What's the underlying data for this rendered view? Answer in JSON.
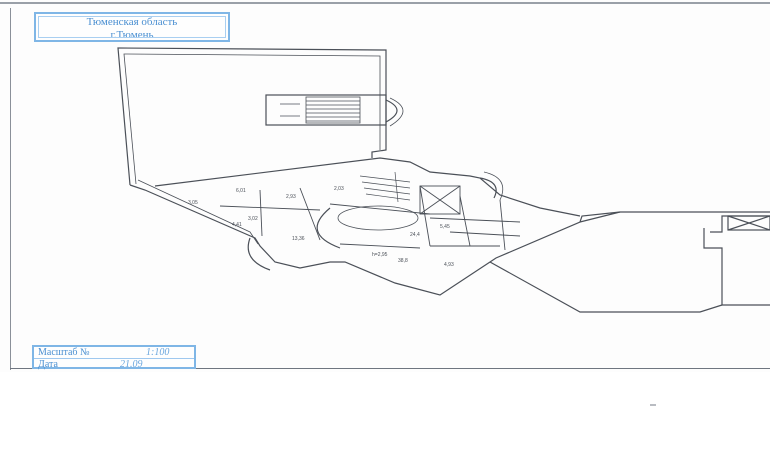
{
  "stamp_region": {
    "line1": "Тюменская область",
    "line2": "г.Тюмень"
  },
  "stamp_scale": {
    "scale_label": "Масштаб №",
    "scale_value": "1:100",
    "date_label": "Дата",
    "date_value": "21.09"
  },
  "room_labels": [
    "3,05",
    "6,01",
    "2,93",
    "3,02",
    "2,03",
    "5,45",
    "13,36",
    "4,41",
    "24,4",
    "h=2,95",
    "38,8",
    "4,93"
  ],
  "colors": {
    "stamp": "#4a8fd1",
    "line": "#4b5058"
  }
}
